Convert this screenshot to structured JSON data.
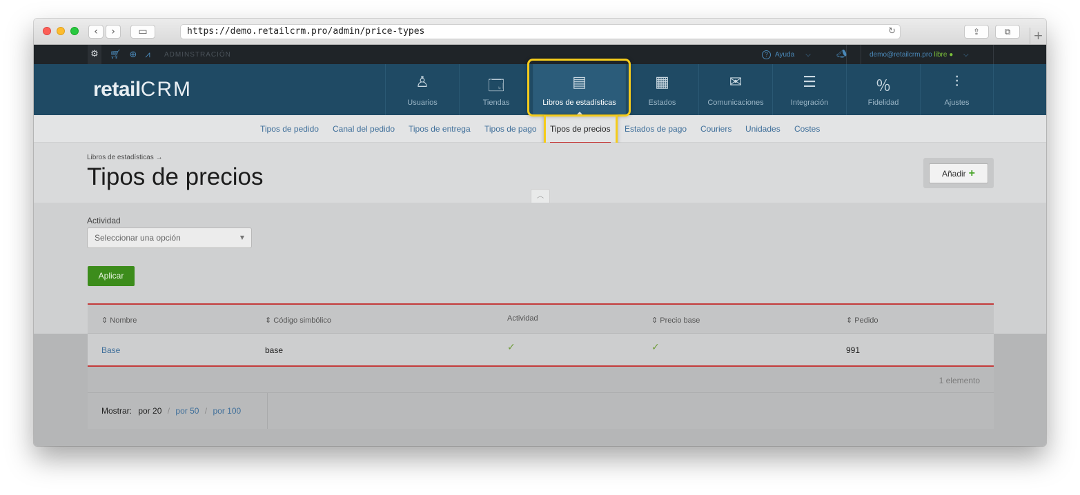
{
  "browser": {
    "url": "https://demo.retailcrm.pro/admin/price-types",
    "back_glyph": "‹",
    "forward_glyph": "›",
    "sidebar_glyph": "▭",
    "reload_glyph": "↻",
    "share_glyph": "⇪",
    "tabs_glyph": "⧉",
    "newtab_glyph": "+"
  },
  "adminbar": {
    "icons": [
      "gear-icon",
      "cart-icon",
      "target-icon",
      "chart-icon"
    ],
    "label": "ADMINSTRACIÓN",
    "help": "Ayuda",
    "user_email": "demo@retailcrm.pro",
    "user_status": "libre"
  },
  "logo": {
    "retail": "retail",
    "crm": "CRM"
  },
  "mainnav": {
    "items": [
      {
        "label": "Usuarios",
        "icon": "user-icon"
      },
      {
        "label": "Tiendas",
        "icon": "store-icon"
      },
      {
        "label": "Libros de estadísticas",
        "icon": "book-icon"
      },
      {
        "label": "Estados",
        "icon": "statuses-icon"
      },
      {
        "label": "Comunicaciones",
        "icon": "mail-icon"
      },
      {
        "label": "Integración",
        "icon": "integration-icon"
      },
      {
        "label": "Fidelidad",
        "icon": "loyalty-icon"
      },
      {
        "label": "Ajustes",
        "icon": "settings-sliders-icon"
      }
    ],
    "active": "Libros de estadísticas"
  },
  "subnav": {
    "items": [
      "Tipos de pedido",
      "Canal del pedido",
      "Tipos de entrega",
      "Tipos de pago",
      "Tipos de precios",
      "Estados de pago",
      "Couriers",
      "Unidades",
      "Costes"
    ],
    "active": "Tipos de precios"
  },
  "page": {
    "breadcrumb": "Libros de estadísticas →",
    "title": "Tipos de precios",
    "add_button": "Añadir",
    "add_plus": "+"
  },
  "filter": {
    "label": "Actividad",
    "select_placeholder": "Seleccionar una opción",
    "apply_button": "Aplicar"
  },
  "table": {
    "headers": [
      "Nombre",
      "Código simbólico",
      "Actividad",
      "Precio base",
      "Pedido"
    ],
    "rows": [
      {
        "nombre": "Base",
        "codigo": "base",
        "actividad": "✓",
        "precio_base": "✓",
        "pedido": "991"
      }
    ],
    "count": "1 elemento"
  },
  "pager": {
    "label": "Mostrar:",
    "options": [
      "por 20",
      "por 50",
      "por 100"
    ],
    "current": "por 20"
  },
  "colors": {
    "highlight": "#f5cc1c",
    "nav_bg": "#1f4a64",
    "accent_red": "#c43a3a",
    "apply_green": "#3c8c1b"
  }
}
